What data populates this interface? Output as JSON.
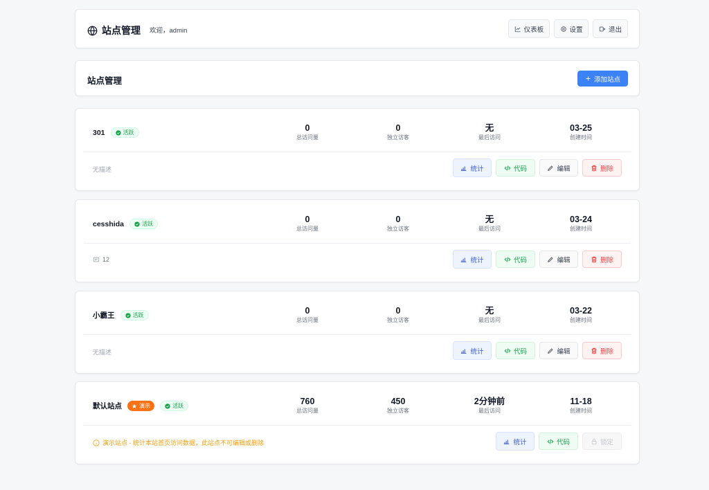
{
  "header": {
    "title": "站点管理",
    "welcome": "欢迎，admin",
    "nav": {
      "dashboard": "仪表板",
      "settings": "设置",
      "logout": "退出"
    }
  },
  "toolbar": {
    "title": "站点管理",
    "add_label": "添加站点"
  },
  "labels": {
    "total_visits": "总访问量",
    "unique_visitors": "独立访客",
    "last_visit": "最后访问",
    "created": "创建时间",
    "stats_btn": "统计",
    "code_btn": "代码",
    "edit_btn": "编辑",
    "delete_btn": "删除",
    "locked_btn": "锁定",
    "active_badge": "活跃",
    "demo_badge": "演示"
  },
  "sites": [
    {
      "name": "301",
      "total_visits": "0",
      "unique_visitors": "0",
      "last_visit": "无",
      "created": "03-25",
      "description": "无描述"
    },
    {
      "name": "cesshida",
      "total_visits": "0",
      "unique_visitors": "0",
      "last_visit": "无",
      "created": "03-24",
      "description": "12"
    },
    {
      "name": "小霸王",
      "total_visits": "0",
      "unique_visitors": "0",
      "last_visit": "无",
      "created": "03-22",
      "description": "无描述"
    },
    {
      "name": "默认站点",
      "total_visits": "760",
      "unique_visitors": "450",
      "last_visit": "2分钟前",
      "created": "11-18",
      "description": "演示站点 - 统计本站首页访问数据，此站点不可编辑或删除"
    }
  ],
  "colors": {
    "primary": "#3b82f6",
    "active_green": "#16a34a",
    "demo_orange": "#f97316",
    "danger": "#ef4444",
    "note": "#f59e0b"
  }
}
